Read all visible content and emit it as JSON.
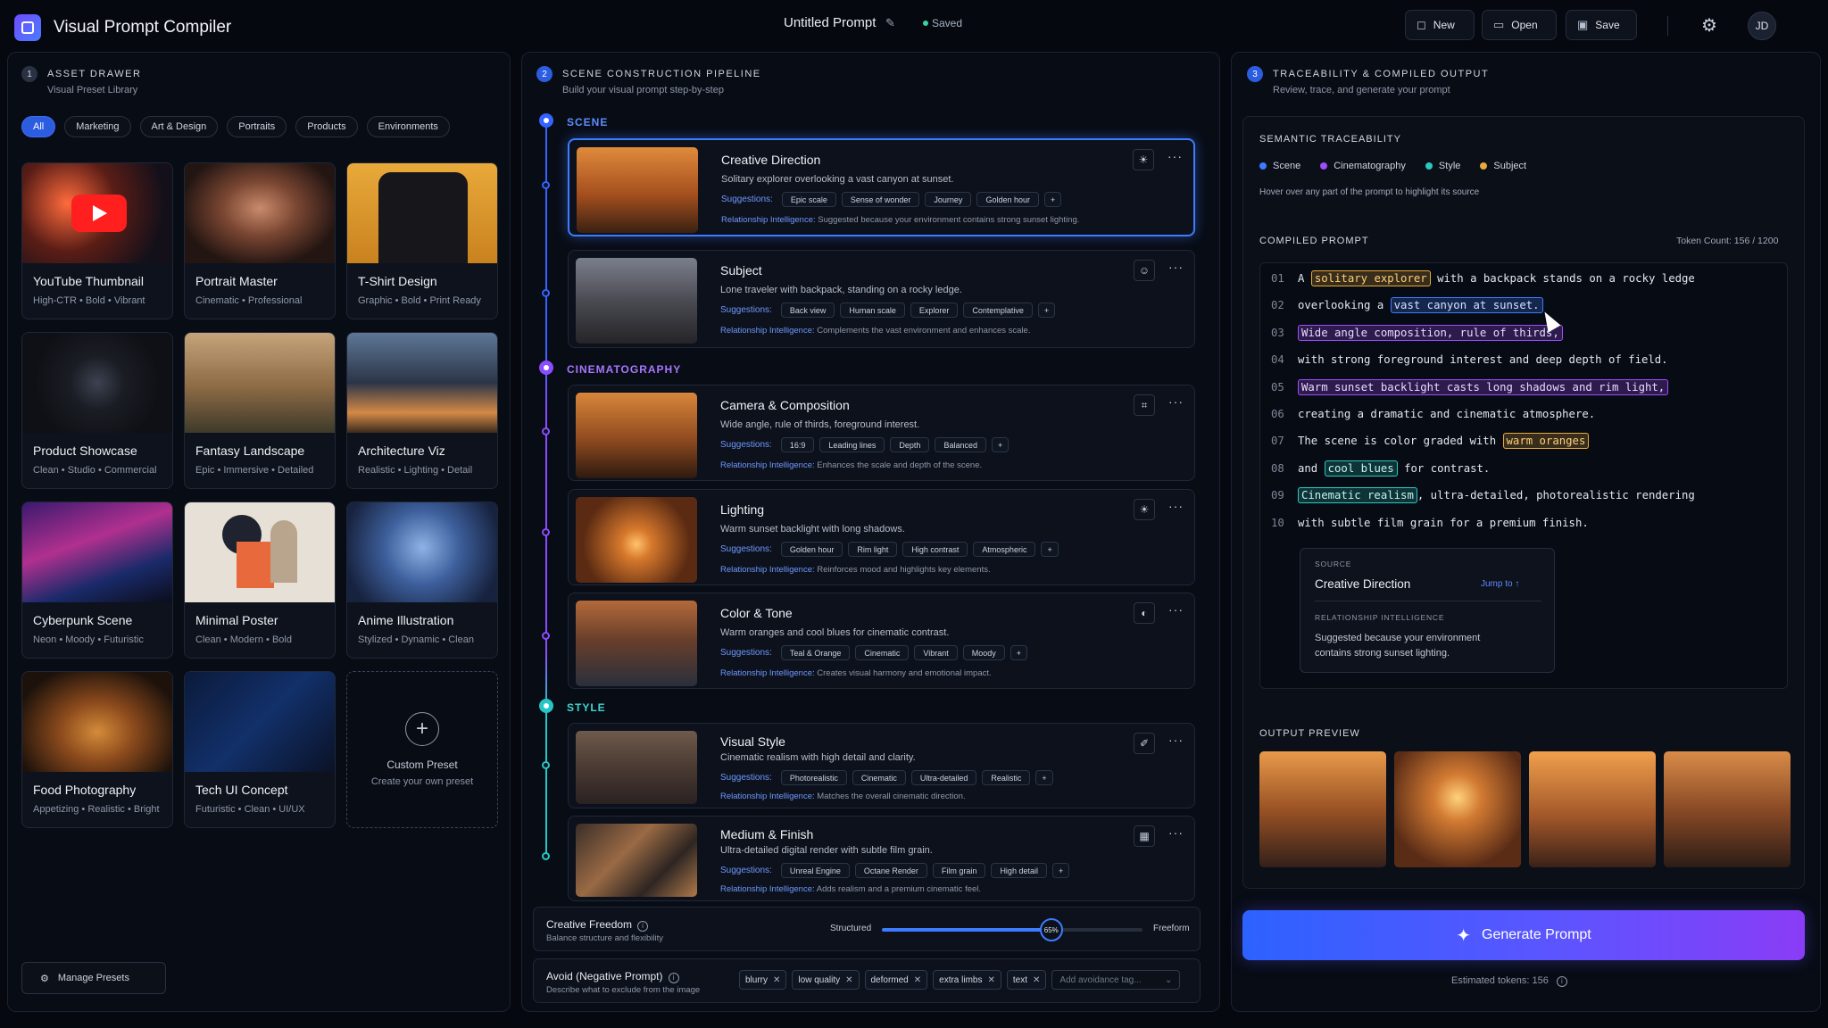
{
  "header": {
    "app_title": "Visual Prompt Compiler",
    "doc_title": "Untitled Prompt",
    "save_status": "Saved",
    "new_label": "New",
    "open_label": "Open",
    "save_label": "Save",
    "user_initials": "JD"
  },
  "asset_drawer": {
    "step": "1",
    "title": "ASSET DRAWER",
    "subtitle": "Visual Preset Library",
    "filters": [
      "All",
      "Marketing",
      "Art & Design",
      "Portraits",
      "Products",
      "Environments"
    ],
    "presets": [
      {
        "title": "YouTube Thumbnail",
        "tags": "High-CTR • Bold • Vibrant"
      },
      {
        "title": "Portrait Master",
        "tags": "Cinematic • Professional"
      },
      {
        "title": "T-Shirt Design",
        "tags": "Graphic • Bold • Print Ready"
      },
      {
        "title": "Product Showcase",
        "tags": "Clean • Studio • Commercial"
      },
      {
        "title": "Fantasy Landscape",
        "tags": "Epic • Immersive • Detailed"
      },
      {
        "title": "Architecture Viz",
        "tags": "Realistic • Lighting • Detail"
      },
      {
        "title": "Cyberpunk Scene",
        "tags": "Neon • Moody • Futuristic"
      },
      {
        "title": "Minimal Poster",
        "tags": "Clean • Modern • Bold"
      },
      {
        "title": "Anime Illustration",
        "tags": "Stylized • Dynamic • Clean"
      },
      {
        "title": "Food Photography",
        "tags": "Appetizing • Realistic • Bright"
      },
      {
        "title": "Tech UI Concept",
        "tags": "Futuristic • Clean • UI/UX"
      }
    ],
    "custom": {
      "title": "Custom Preset",
      "subtitle": "Create your own preset"
    },
    "manage_label": "Manage Presets"
  },
  "pipeline": {
    "step": "2",
    "title": "SCENE CONSTRUCTION PIPELINE",
    "subtitle": "Build your visual prompt step-by-step",
    "sections": {
      "scene": "SCENE",
      "cinematography": "CINEMATOGRAPHY",
      "style": "STYLE"
    },
    "suggestions_label": "Suggestions:",
    "rel_label": "Relationship Intelligence:",
    "cards": [
      {
        "title": "Creative Direction",
        "desc": "Solitary explorer overlooking a vast canyon at sunset.",
        "tags": [
          "Epic scale",
          "Sense of wonder",
          "Journey",
          "Golden hour"
        ],
        "rel": "Suggested because your environment contains strong sunset lighting.",
        "icon": "sun-icon"
      },
      {
        "title": "Subject",
        "desc": "Lone traveler with backpack, standing on a rocky ledge.",
        "tags": [
          "Back view",
          "Human scale",
          "Explorer",
          "Contemplative"
        ],
        "rel": "Complements the vast environment and enhances scale.",
        "icon": "person-icon"
      },
      {
        "title": "Camera & Composition",
        "desc": "Wide angle, rule of thirds, foreground interest.",
        "tags": [
          "16:9",
          "Leading lines",
          "Depth",
          "Balanced"
        ],
        "rel": "Enhances the scale and depth of the scene.",
        "icon": "frame-icon"
      },
      {
        "title": "Lighting",
        "desc": "Warm sunset backlight with long shadows.",
        "tags": [
          "Golden hour",
          "Rim light",
          "High contrast",
          "Atmospheric"
        ],
        "rel": "Reinforces mood and highlights key elements.",
        "icon": "sun-icon"
      },
      {
        "title": "Color & Tone",
        "desc": "Warm oranges and cool blues for cinematic contrast.",
        "tags": [
          "Teal & Orange",
          "Cinematic",
          "Vibrant",
          "Moody"
        ],
        "rel": "Creates visual harmony and emotional impact.",
        "icon": "palette-icon"
      },
      {
        "title": "Visual Style",
        "desc": "Cinematic realism with high detail and clarity.",
        "tags": [
          "Photorealistic",
          "Cinematic",
          "Ultra-detailed",
          "Realistic"
        ],
        "rel": "Matches the overall cinematic direction.",
        "icon": "brush-icon"
      },
      {
        "title": "Medium & Finish",
        "desc": "Ultra-detailed digital render with subtle film grain.",
        "tags": [
          "Unreal Engine",
          "Octane Render",
          "Film grain",
          "High detail"
        ],
        "rel": "Adds realism and a premium cinematic feel.",
        "icon": "grid-icon"
      }
    ],
    "freedom": {
      "title": "Creative Freedom",
      "subtitle": "Balance structure and flexibility",
      "left": "Structured",
      "right": "Freeform",
      "value": 65,
      "value_label": "65%"
    },
    "avoid": {
      "title": "Avoid (Negative Prompt)",
      "subtitle": "Describe what to exclude from the image",
      "tags": [
        "blurry",
        "low quality",
        "deformed",
        "extra limbs",
        "text"
      ],
      "placeholder": "Add avoidance tag..."
    }
  },
  "output": {
    "step": "3",
    "title": "TRACEABILITY & COMPILED OUTPUT",
    "subtitle": "Review, trace, and generate your prompt",
    "trace_title": "SEMANTIC TRACEABILITY",
    "legend": [
      {
        "name": "Scene",
        "color": "#3d7bff"
      },
      {
        "name": "Cinematography",
        "color": "#a14cff"
      },
      {
        "name": "Style",
        "color": "#2cc8c0"
      },
      {
        "name": "Subject",
        "color": "#e8a93a"
      }
    ],
    "hint": "Hover over any part of the prompt to highlight its source",
    "compiled_title": "COMPILED PROMPT",
    "token_count": "Token Count: 156 / 1200",
    "lines": [
      {
        "n": "01",
        "parts": [
          [
            "A ",
            ""
          ],
          [
            "solitary explorer",
            "sub"
          ],
          [
            " with a backpack stands on a rocky ledge",
            ""
          ]
        ]
      },
      {
        "n": "02",
        "parts": [
          [
            "overlooking a ",
            ""
          ],
          [
            "vast canyon at sunset.",
            "scn"
          ]
        ]
      },
      {
        "n": "03",
        "parts": [
          [
            "Wide angle composition, rule of thirds,",
            "cin"
          ]
        ]
      },
      {
        "n": "04",
        "parts": [
          [
            "with strong foreground interest and deep depth of field.",
            ""
          ]
        ]
      },
      {
        "n": "05",
        "parts": [
          [
            "Warm sunset backlight casts long shadows and rim light,",
            "cin"
          ]
        ]
      },
      {
        "n": "06",
        "parts": [
          [
            "creating a dramatic and cinematic atmosphere.",
            ""
          ]
        ]
      },
      {
        "n": "07",
        "parts": [
          [
            "The scene is color graded with ",
            ""
          ],
          [
            "warm oranges",
            "sub"
          ]
        ]
      },
      {
        "n": "08",
        "parts": [
          [
            "and ",
            ""
          ],
          [
            "cool blues",
            "sty"
          ],
          [
            " for contrast.",
            ""
          ]
        ]
      },
      {
        "n": "09",
        "parts": [
          [
            "Cinematic realism",
            "sty"
          ],
          [
            ", ultra-detailed, photorealistic rendering",
            ""
          ]
        ]
      },
      {
        "n": "10",
        "parts": [
          [
            "with subtle film grain for a premium finish.",
            ""
          ]
        ]
      }
    ],
    "source": {
      "label": "SOURCE",
      "name": "Creative Direction",
      "jump": "Jump to",
      "rel_label": "RELATIONSHIP INTELLIGENCE",
      "rel_text": "Suggested because your environment contains strong sunset lighting."
    },
    "preview_title": "OUTPUT PREVIEW",
    "generate_label": "Generate Prompt",
    "estimated": "Estimated tokens: 156"
  }
}
